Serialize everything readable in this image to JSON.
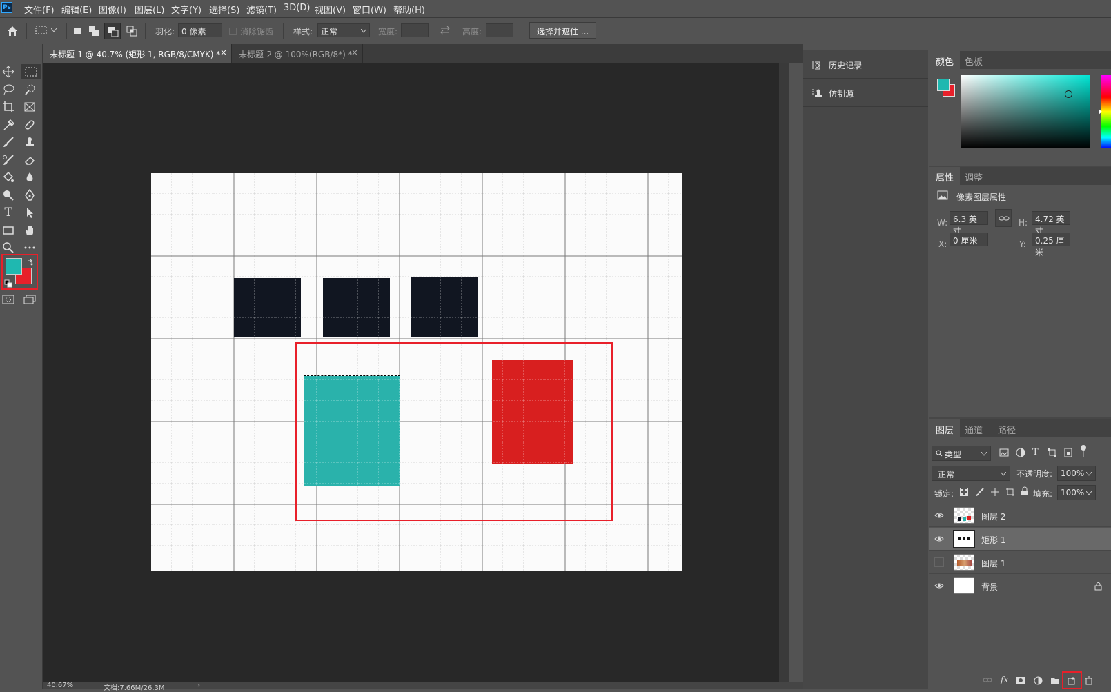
{
  "app": {
    "logo": "Ps"
  },
  "menu": [
    "文件(F)",
    "编辑(E)",
    "图像(I)",
    "图层(L)",
    "文字(Y)",
    "选择(S)",
    "滤镜(T)",
    "3D(D)",
    "视图(V)",
    "窗口(W)",
    "帮助(H)"
  ],
  "options": {
    "feather_label": "羽化:",
    "feather_value": "0 像素",
    "antialias_label": "消除锯齿",
    "style_label": "样式:",
    "style_value": "正常",
    "width_label": "宽度:",
    "height_label": "高度:",
    "select_mask_button": "选择并遮住 ..."
  },
  "tabs": [
    {
      "label": "未标题-1 @ 40.7% (矩形 1, RGB/8/CMYK) *",
      "close": "×"
    },
    {
      "label": "未标题-2 @ 100%(RGB/8*) *",
      "close": "×"
    }
  ],
  "status": {
    "zoom": "40.67%",
    "doc": "文档:7.66M/26.3M",
    "arrow": "›"
  },
  "left_panels": [
    {
      "label": "历史记录",
      "icon": "history-icon"
    },
    {
      "label": "仿制源",
      "icon": "clone-source-icon"
    }
  ],
  "color_panel": {
    "tabs": [
      "颜色",
      "色板"
    ],
    "foreground": "#1fb8b0",
    "background": "#e8202a"
  },
  "properties_panel": {
    "tabs": [
      "属性",
      "调整"
    ],
    "title": "像素图层属性",
    "w_label": "W:",
    "w_value": "6.3 英寸",
    "h_label": "H:",
    "h_value": "4.72 英寸",
    "x_label": "X:",
    "x_value": "0 厘米",
    "y_label": "Y:",
    "y_value": "0.25 厘米"
  },
  "layers_panel": {
    "tabs": [
      "图层",
      "通道",
      "路径"
    ],
    "filter_label": "类型",
    "blend_mode": "正常",
    "opacity_label": "不透明度:",
    "opacity_value": "100%",
    "lock_label": "锁定:",
    "fill_label": "填充:",
    "fill_value": "100%",
    "layers": [
      {
        "name": "图层 2",
        "visible": true
      },
      {
        "name": "矩形 1",
        "visible": true,
        "selected": true
      },
      {
        "name": "图层 1",
        "visible": false
      },
      {
        "name": "背景",
        "visible": true,
        "locked": true
      }
    ]
  },
  "canvas_colors": {
    "dark_rect": "#111621",
    "teal": "#2ab2ab",
    "red": "#d81f1f",
    "highlight": "#e8202a"
  }
}
